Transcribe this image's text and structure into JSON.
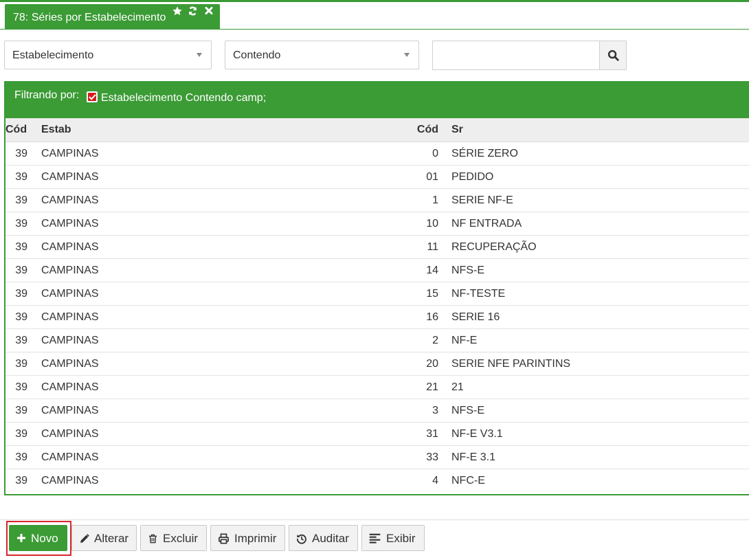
{
  "tab": {
    "title": "78: Séries por Estabelecimento",
    "icons": [
      "star-icon",
      "refresh-icon",
      "close-icon"
    ]
  },
  "filters": {
    "field_select": "Estabelecimento",
    "operator_select": "Contendo",
    "search_value": "",
    "search_icon": "search-icon"
  },
  "filter_bar": {
    "label": "Filtrando por:",
    "checked": true,
    "text": "Estabelecimento Contendo camp;"
  },
  "table": {
    "columns": [
      "Cód",
      "Estab",
      "Cód",
      "Sr"
    ],
    "rows": [
      [
        "39",
        "CAMPINAS",
        "0",
        "SÉRIE ZERO"
      ],
      [
        "39",
        "CAMPINAS",
        "01",
        "PEDIDO"
      ],
      [
        "39",
        "CAMPINAS",
        "1",
        "SERIE NF-E"
      ],
      [
        "39",
        "CAMPINAS",
        "10",
        "NF ENTRADA"
      ],
      [
        "39",
        "CAMPINAS",
        "11",
        "RECUPERAÇÃO"
      ],
      [
        "39",
        "CAMPINAS",
        "14",
        "NFS-E"
      ],
      [
        "39",
        "CAMPINAS",
        "15",
        "NF-TESTE"
      ],
      [
        "39",
        "CAMPINAS",
        "16",
        "SERIE 16"
      ],
      [
        "39",
        "CAMPINAS",
        "2",
        "NF-E"
      ],
      [
        "39",
        "CAMPINAS",
        "20",
        "SERIE NFE PARINTINS"
      ],
      [
        "39",
        "CAMPINAS",
        "21",
        "21"
      ],
      [
        "39",
        "CAMPINAS",
        "3",
        "NFS-E"
      ],
      [
        "39",
        "CAMPINAS",
        "31",
        "NF-E V3.1"
      ],
      [
        "39",
        "CAMPINAS",
        "33",
        "NF-E 3.1"
      ],
      [
        "39",
        "CAMPINAS",
        "4",
        "NFC-E"
      ]
    ]
  },
  "toolbar": {
    "novo": "Novo",
    "alterar": "Alterar",
    "excluir": "Excluir",
    "imprimir": "Imprimir",
    "auditar": "Auditar",
    "exibir": "Exibir"
  },
  "colors": {
    "accent": "#3b9b35",
    "highlight": "#d9262c",
    "checkbox": "#d41c1c"
  }
}
